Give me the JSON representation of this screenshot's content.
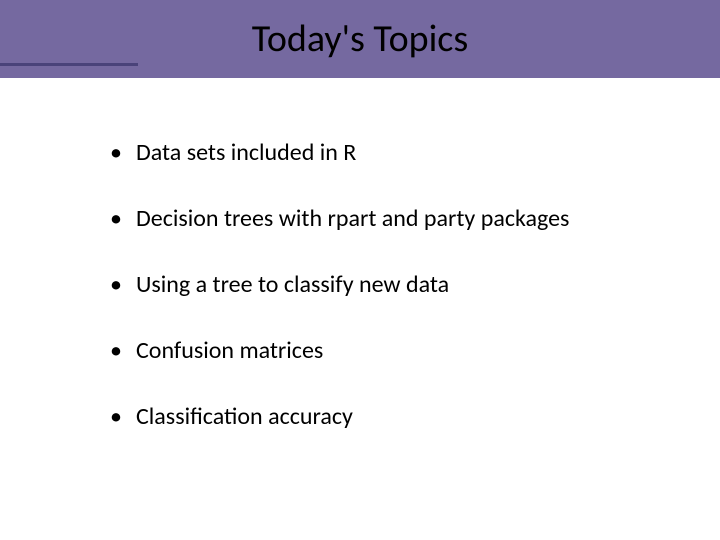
{
  "title": "Today's Topics",
  "bullets": [
    "Data sets included in R",
    "Decision trees with rpart and party packages",
    "Using a tree to classify new data",
    "Confusion matrices",
    "Classification accuracy"
  ]
}
